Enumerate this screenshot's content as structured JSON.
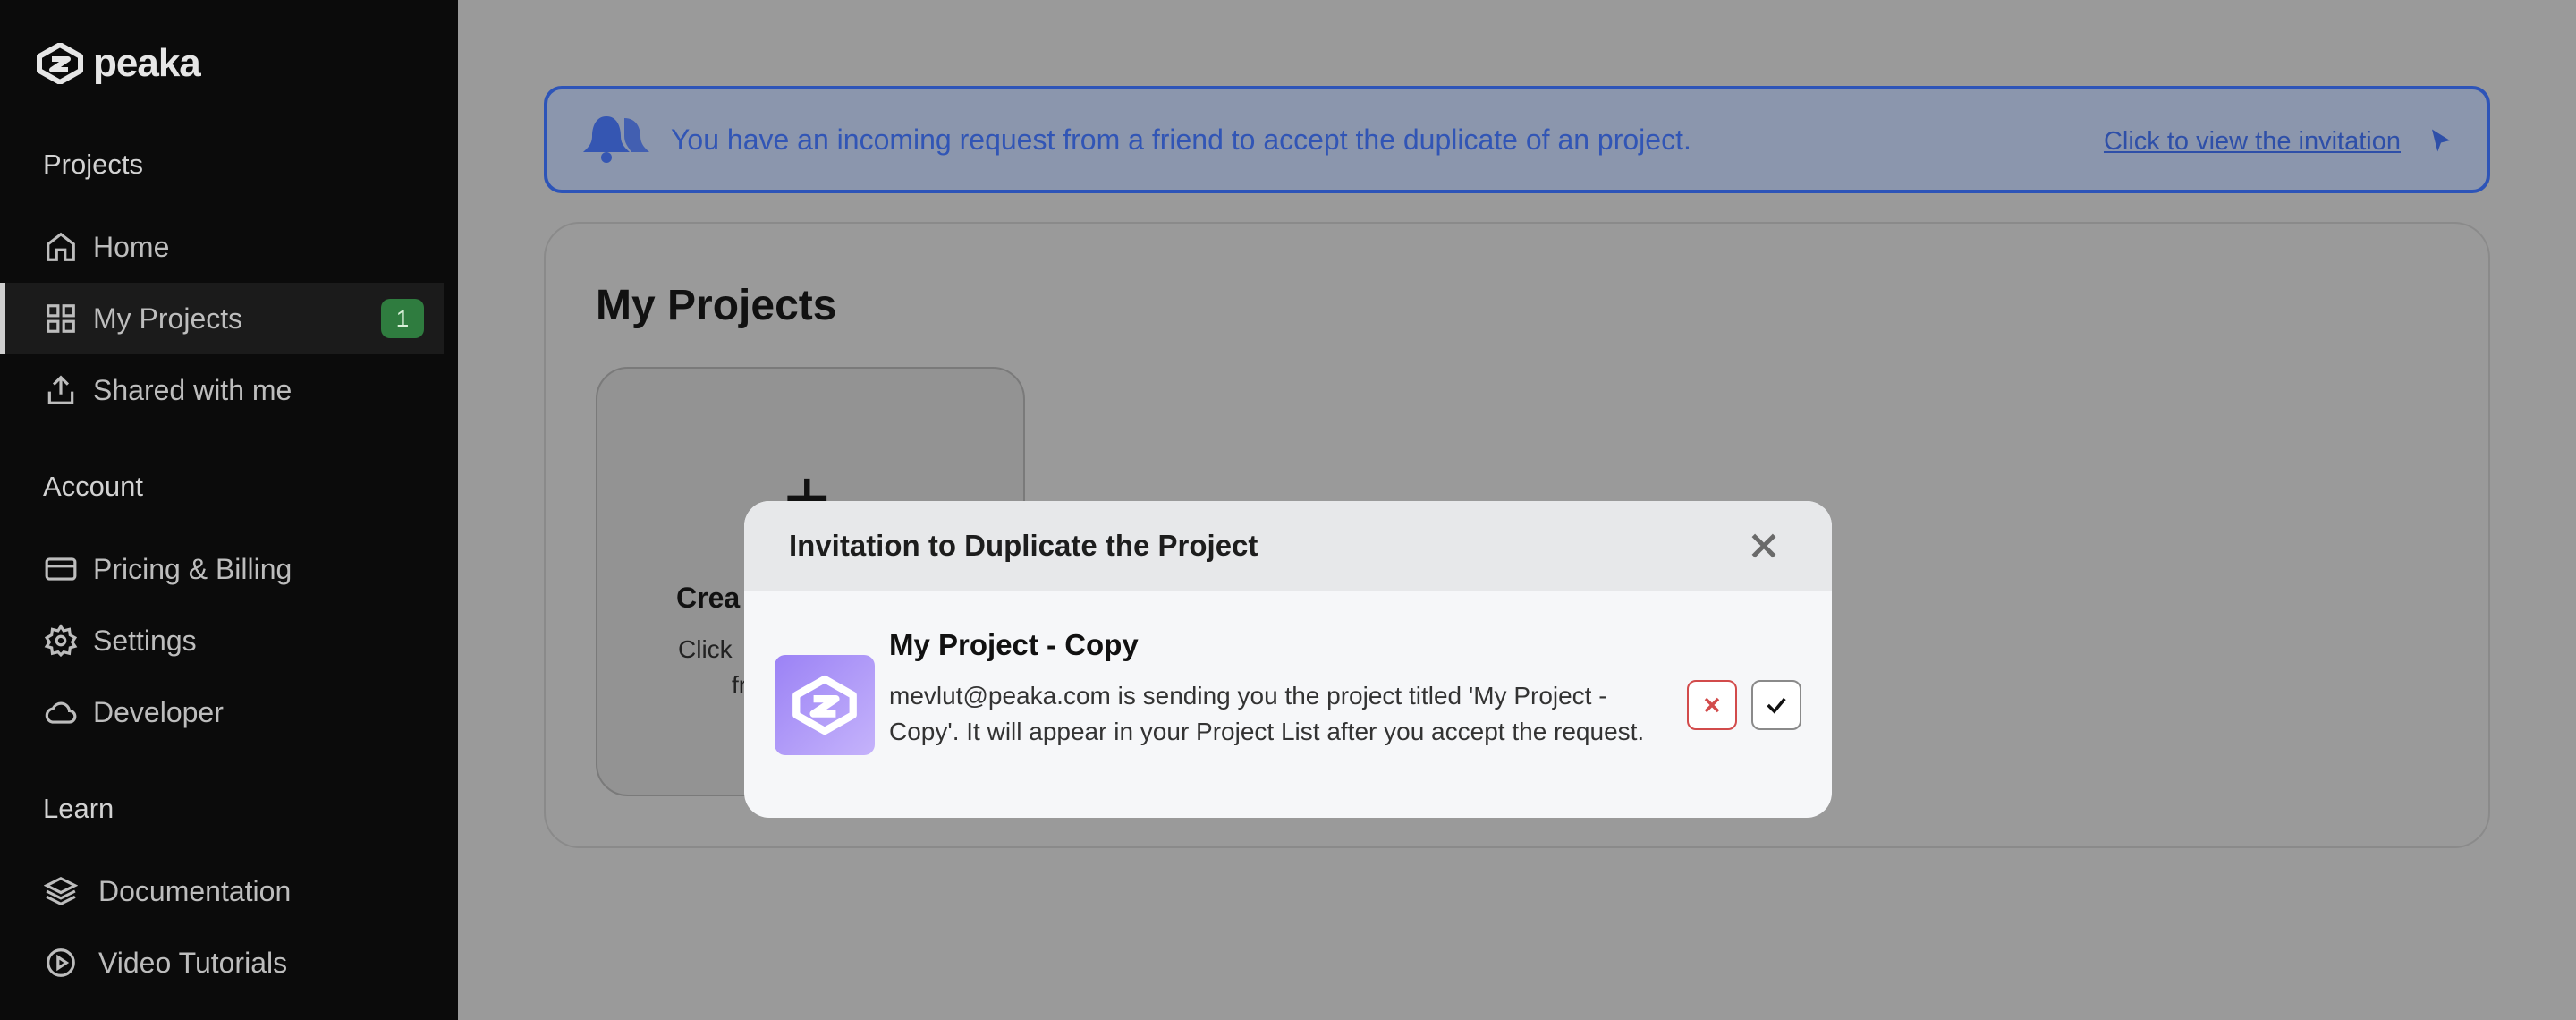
{
  "logo": {
    "text": "peaka"
  },
  "sidebar": {
    "sections": [
      {
        "title": "Projects"
      },
      {
        "title": "Account"
      },
      {
        "title": "Learn"
      }
    ],
    "items": [
      {
        "label": "Home",
        "icon": "home-icon"
      },
      {
        "label": "My Projects",
        "icon": "grid-icon",
        "badge": "1",
        "active": true
      },
      {
        "label": "Shared with me",
        "icon": "share-icon"
      },
      {
        "label": "Pricing & Billing",
        "icon": "credit-card-icon"
      },
      {
        "label": "Settings",
        "icon": "gear-icon"
      },
      {
        "label": "Developer",
        "icon": "cloud-icon"
      },
      {
        "label": "Documentation",
        "icon": "layers-icon"
      },
      {
        "label": "Video Tutorials",
        "icon": "play-circle-icon"
      }
    ]
  },
  "banner": {
    "text": "You have an incoming request from a friend to accept the duplicate of an project.",
    "link": "Click to view the invitation"
  },
  "main": {
    "title": "My Projects",
    "create_card": {
      "title": "Crea",
      "desc_line1": "Click",
      "desc_line2": "fr"
    }
  },
  "modal": {
    "title": "Invitation to Duplicate the Project",
    "project_name": "My Project - Copy",
    "description": "mevlut@peaka.com is sending you the project titled 'My Project - Copy'. It will appear in your Project List after you accept the request."
  },
  "colors": {
    "accent": "#2d54b8",
    "badge": "#2f7c3f",
    "reject": "#d24b4b"
  }
}
